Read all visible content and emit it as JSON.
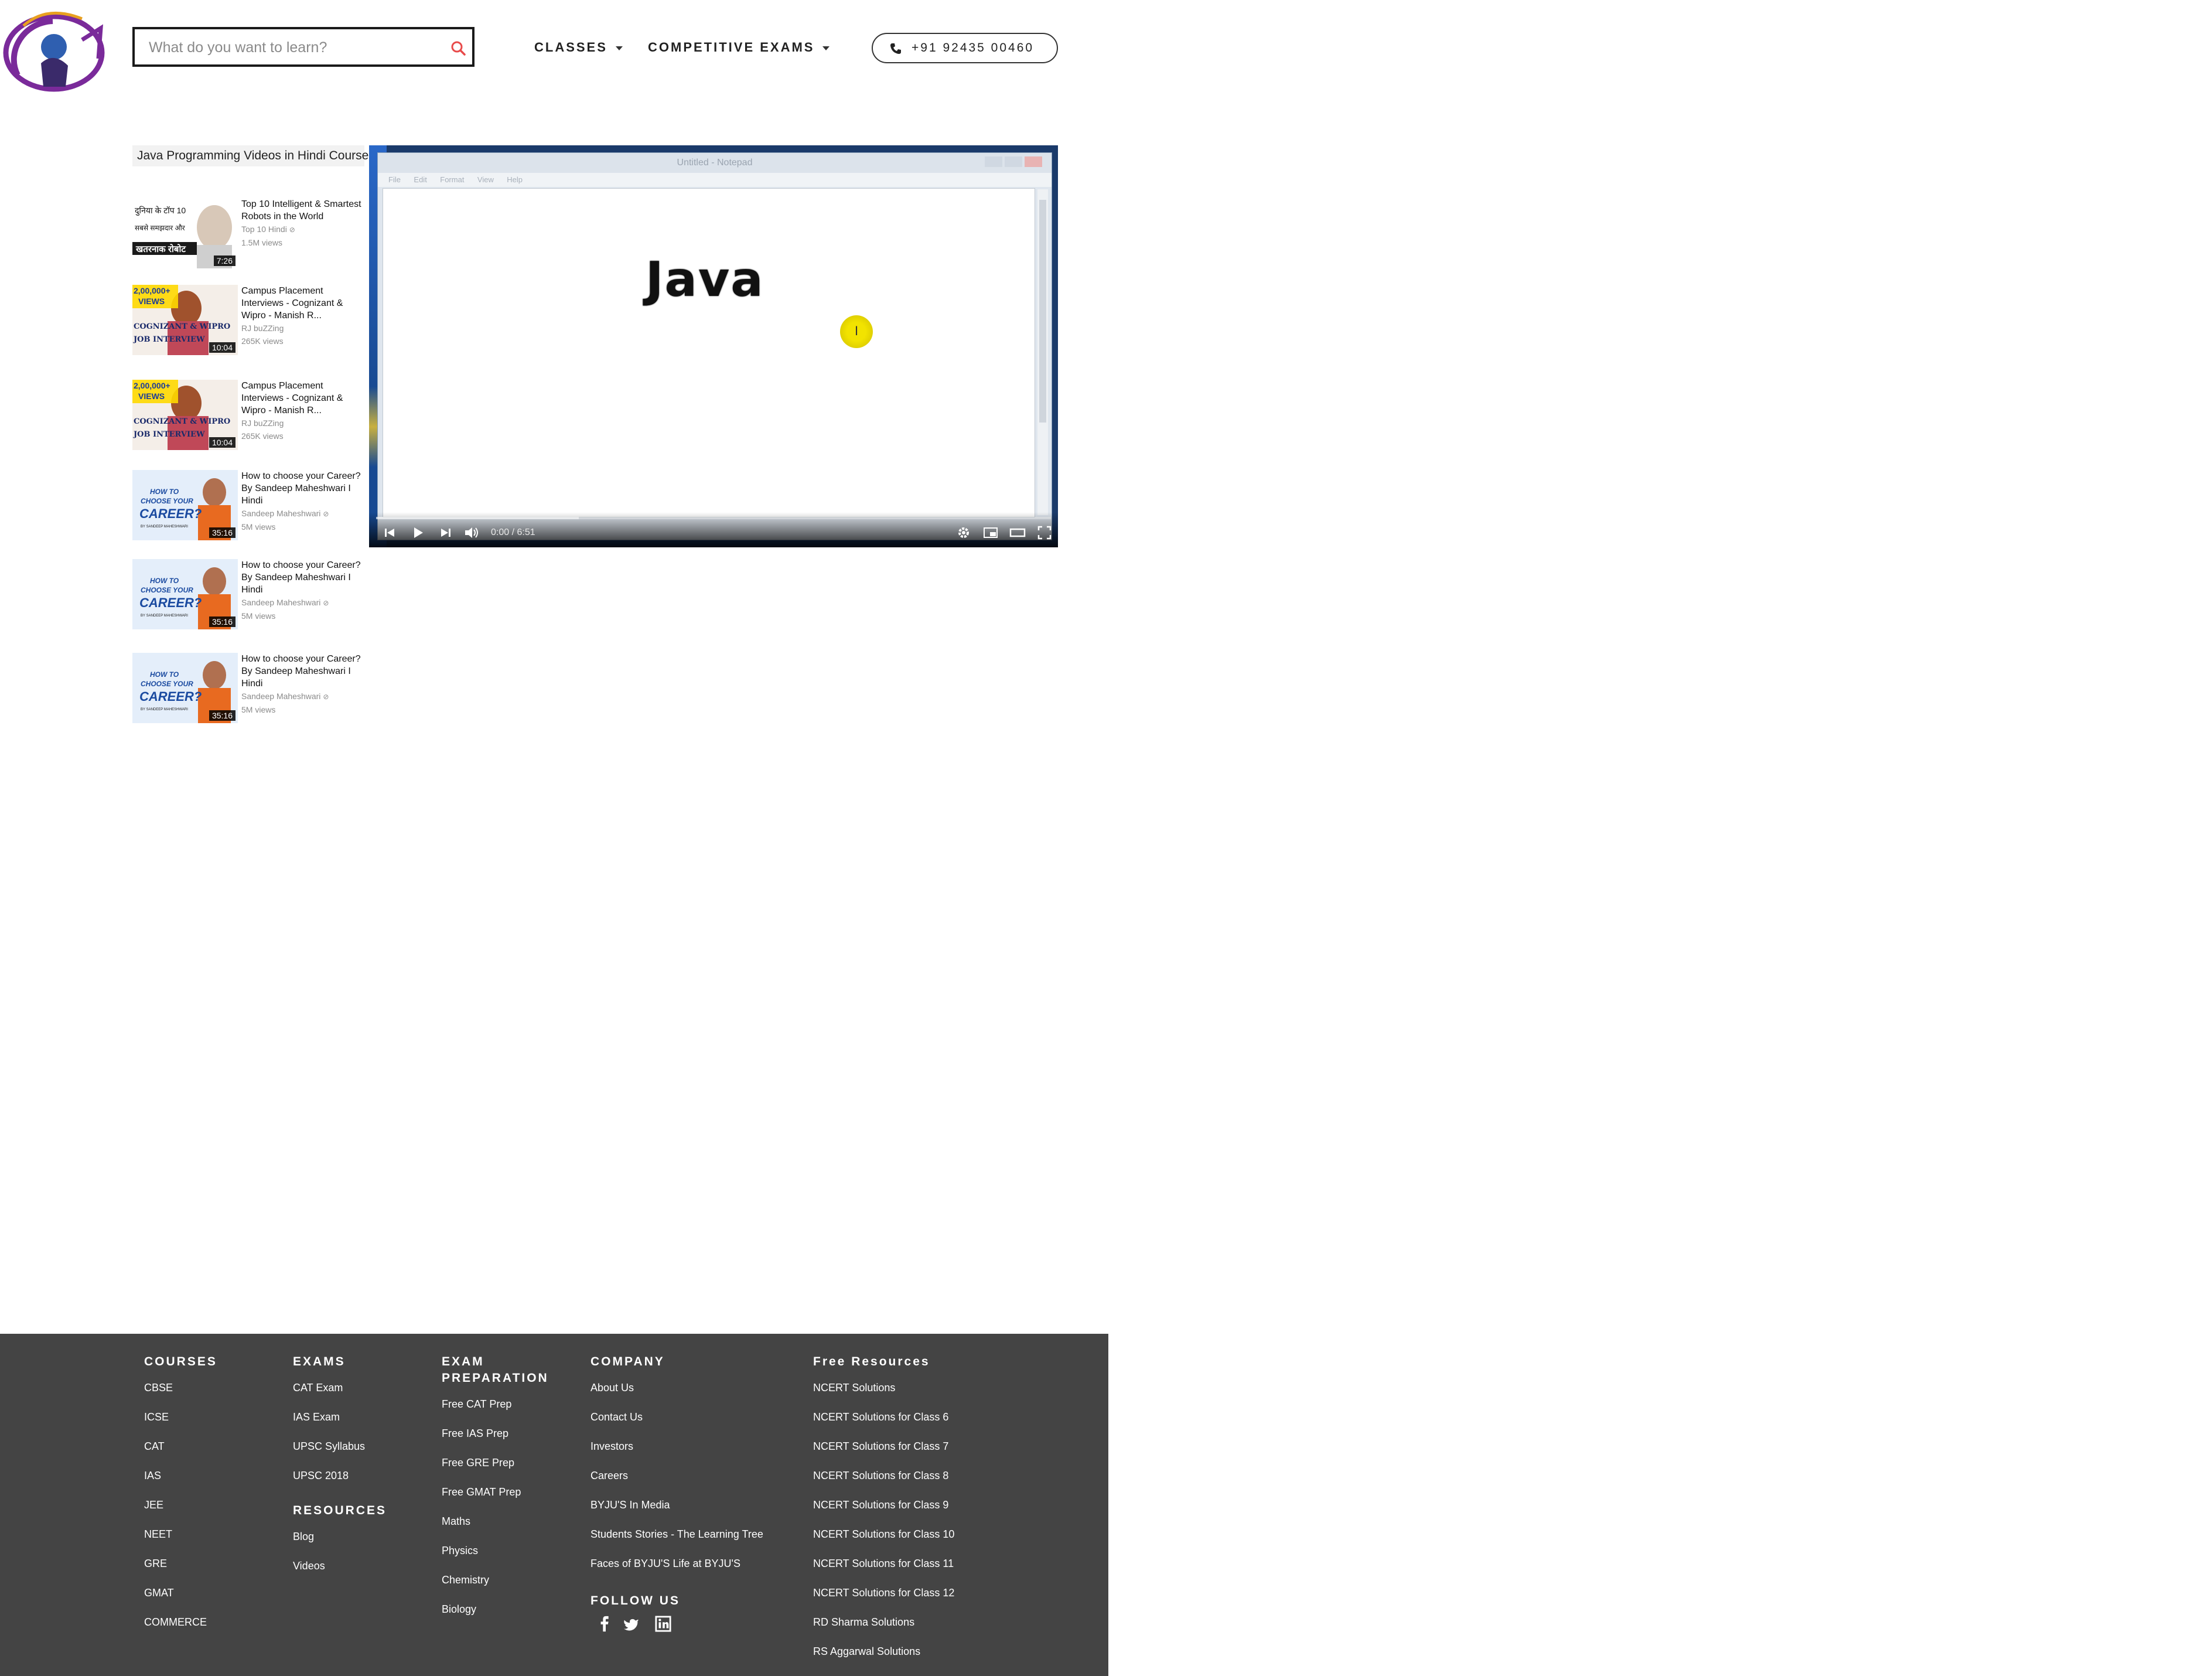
{
  "header": {
    "search_placeholder": "What do you want to learn?",
    "nav": [
      {
        "label": "CLASSES"
      },
      {
        "label": "COMPETITIVE EXAMS"
      }
    ],
    "phone": "+91 92435 00460",
    "accent_color": "#e84a4a"
  },
  "playlist": {
    "title": "Java Programming Videos in Hindi Course",
    "items": [
      {
        "title": "Top 10 Intelligent & Smartest Robots in the World",
        "channel": "Top 10 Hindi",
        "views": "1.5M views",
        "duration": "7:26",
        "thumb_text": [
          "दुनिया के टॉप 10",
          "सबसे समझदार और",
          "खतरनाक रोबोट"
        ]
      },
      {
        "title": "Campus Placement Interviews - Cognizant & Wipro - Manish R...",
        "channel": "RJ buZZing",
        "views": "265K views",
        "duration": "10:04",
        "thumb_text": [
          "2,00,000+",
          "VIEWS",
          "COGNIZANT & WIPRO",
          "JOB INTERVIEW"
        ]
      },
      {
        "title": "Campus Placement Interviews - Cognizant & Wipro - Manish R...",
        "channel": "RJ buZZing",
        "views": "265K views",
        "duration": "10:04",
        "thumb_text": [
          "2,00,000+",
          "VIEWS",
          "COGNIZANT & WIPRO",
          "JOB INTERVIEW"
        ]
      },
      {
        "title": "How to choose your Career? By Sandeep Maheshwari I Hindi",
        "channel": "Sandeep Maheshwari",
        "views": "5M views",
        "duration": "35:16",
        "thumb_text": [
          "HOW TO",
          "CHOOSE YOUR",
          "CAREER?",
          "BY SANDEEP MAHESHWARI"
        ]
      },
      {
        "title": "How to choose your Career? By Sandeep Maheshwari I Hindi",
        "channel": "Sandeep Maheshwari",
        "views": "5M views",
        "duration": "35:16",
        "thumb_text": [
          "HOW TO",
          "CHOOSE YOUR",
          "CAREER?",
          "BY SANDEEP MAHESHWARI"
        ]
      },
      {
        "title": "How to choose your Career? By Sandeep Maheshwari I Hindi",
        "channel": "Sandeep Maheshwari",
        "views": "5M views",
        "duration": "35:16",
        "thumb_text": [
          "HOW TO",
          "CHOOSE YOUR",
          "CAREER?",
          "BY SANDEEP MAHESHWARI"
        ]
      }
    ]
  },
  "player": {
    "window_title": "Untitled - Notepad",
    "menu": [
      "File",
      "Edit",
      "Format",
      "View",
      "Help"
    ],
    "content_text": "Java",
    "cursor_glyph": "I",
    "time": "0:00 / 6:51",
    "buffered_fraction": 0.3
  },
  "footer": {
    "courses": {
      "heading": "COURSES",
      "links": [
        "CBSE",
        "ICSE",
        "CAT",
        "IAS",
        "JEE",
        "NEET",
        "GRE",
        "GMAT",
        "COMMERCE"
      ]
    },
    "exams": {
      "heading": "EXAMS",
      "links": [
        "CAT Exam",
        "IAS Exam",
        "UPSC Syllabus",
        "UPSC 2018"
      ]
    },
    "resources": {
      "heading": "RESOURCES",
      "links": [
        "Blog",
        "Videos"
      ]
    },
    "exam_prep": {
      "heading_line1": "EXAM",
      "heading_line2": "PREPARATION",
      "links": [
        "Free CAT Prep",
        "Free IAS Prep",
        "Free GRE Prep",
        "Free GMAT Prep",
        "Maths",
        "Physics",
        "Chemistry",
        "Biology"
      ]
    },
    "company": {
      "heading": "COMPANY",
      "links": [
        "About Us",
        "Contact Us",
        "Investors",
        "Careers",
        "BYJU'S In Media",
        "Students Stories - The Learning Tree",
        "Faces of BYJU'S Life at BYJU'S"
      ]
    },
    "follow": {
      "heading": "FOLLOW US",
      "icons": [
        "facebook-icon",
        "twitter-icon",
        "linkedin-icon"
      ]
    },
    "free_resources": {
      "heading": "Free Resources",
      "links": [
        "NCERT Solutions",
        "NCERT Solutions for Class 6",
        "NCERT Solutions for Class 7",
        "NCERT Solutions for Class 8",
        "NCERT Solutions for Class 9",
        "NCERT Solutions for Class 10",
        "NCERT Solutions for Class 11",
        "NCERT Solutions for Class 12",
        "RD Sharma Solutions",
        "RS Aggarwal Solutions"
      ]
    },
    "background_color": "#444444"
  }
}
